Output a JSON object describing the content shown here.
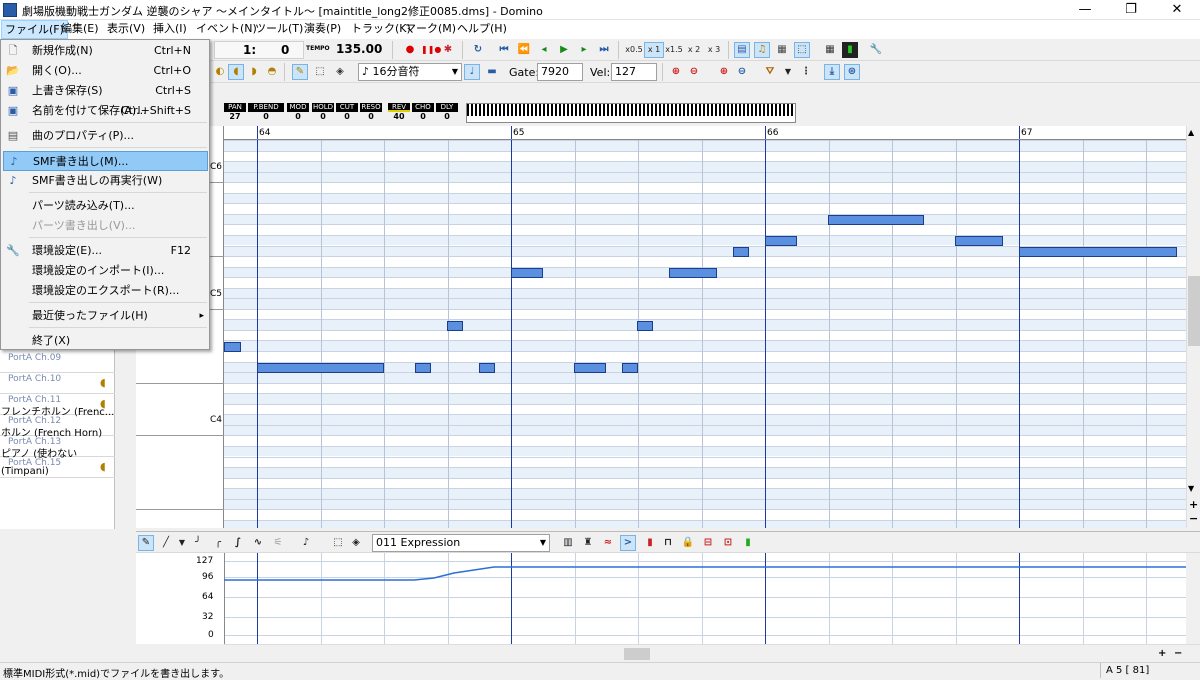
{
  "window": {
    "title": "劇場版機動戦士ガンダム 逆襲のシャア 〜メインタイトル〜 [maintitle_long2修正0085.dms] - Domino",
    "minimize": "—",
    "maximize": "❐",
    "close": "✕"
  },
  "menubar": [
    "ファイル(F)",
    "編集(E)",
    "表示(V)",
    "挿入(I)",
    "イベント(N)",
    "ツール(T)",
    "演奏(P)",
    "トラック(K)",
    "マーク(M)",
    "ヘルプ(H)"
  ],
  "file_menu": {
    "items": [
      {
        "label": "新規作成(N)",
        "shortcut": "Ctrl+N",
        "icon": "new-file-icon"
      },
      {
        "label": "開く(O)...",
        "shortcut": "Ctrl+O",
        "icon": "open-folder-icon"
      },
      {
        "label": "上書き保存(S)",
        "shortcut": "Ctrl+S",
        "icon": "save-icon"
      },
      {
        "label": "名前を付けて保存(A)...",
        "shortcut": "Ctrl+Shift+S",
        "icon": "save-as-icon"
      },
      {
        "label": "曲のプロパティ(P)...",
        "shortcut": "",
        "icon": "properties-icon"
      },
      {
        "label": "SMF書き出し(M)...",
        "shortcut": "",
        "icon": "export-smf-icon",
        "highlighted": true
      },
      {
        "label": "SMF書き出しの再実行(W)",
        "shortcut": "",
        "icon": "reexport-smf-icon"
      },
      {
        "label": "パーツ読み込み(T)...",
        "shortcut": "",
        "icon": ""
      },
      {
        "label": "パーツ書き出し(V)...",
        "shortcut": "",
        "icon": "",
        "disabled": true
      },
      {
        "label": "環境設定(E)...",
        "shortcut": "F12",
        "icon": "wrench-icon"
      },
      {
        "label": "環境設定のインポート(I)...",
        "shortcut": "",
        "icon": ""
      },
      {
        "label": "環境設定のエクスポート(R)...",
        "shortcut": "",
        "icon": ""
      },
      {
        "label": "最近使ったファイル(H)",
        "shortcut": "",
        "icon": "",
        "submenu": true
      },
      {
        "label": "終了(X)",
        "shortcut": "",
        "icon": ""
      }
    ],
    "submenu_arrow": "▸"
  },
  "transport": {
    "position_beat": "1:",
    "position_tick": "0",
    "tempo_label": "TEMPO",
    "tempo": "135.00",
    "speeds": [
      "x0.5",
      "x 1",
      "x1.5",
      "x 2",
      "x 3"
    ]
  },
  "edit_toolbar": {
    "note_length": "16分音符",
    "gate_label": "Gate:",
    "gate": "7920",
    "vel_label": "Vel:",
    "vel": "127"
  },
  "controllers": [
    {
      "name": "PAN",
      "value": "27"
    },
    {
      "name": "P.BEND",
      "value": "0"
    },
    {
      "name": "MOD",
      "value": "0"
    },
    {
      "name": "HOLD",
      "value": "0"
    },
    {
      "name": "CUT",
      "value": "0"
    },
    {
      "name": "RESO",
      "value": "0"
    },
    {
      "name": "REV",
      "value": "40"
    },
    {
      "name": "CHO",
      "value": "0"
    },
    {
      "name": "DLY",
      "value": "0"
    }
  ],
  "tracks": [
    {
      "port": "PortA  Ch.09",
      "name": ""
    },
    {
      "port": "PortA  Ch.10",
      "name": ""
    },
    {
      "port": "PortA  Ch.11",
      "name": "フレンチホルン (Frenc..."
    },
    {
      "port": "PortA  Ch.12",
      "name": "ホルン (French Horn)"
    },
    {
      "port": "PortA  Ch.13",
      "name": "ピアノ (使わない"
    },
    {
      "port": "PortA  Ch.15",
      "name": "(Timpani)"
    }
  ],
  "octave_labels": [
    "C6",
    "C5",
    "C4"
  ],
  "measures": [
    "64",
    "65",
    "66",
    "67"
  ],
  "graph": {
    "controller": "011 Expression",
    "y_labels": [
      "127",
      "96",
      "64",
      "32",
      "0"
    ],
    "values": [
      {
        "tick_start": 0,
        "value": 96
      },
      {
        "tick_ramp_end": 1.0,
        "value": 112
      }
    ]
  },
  "scroll_symbols": {
    "up": "▲",
    "down": "▼",
    "plus": "+",
    "minus": "−",
    "left": "◀",
    "right": "▶"
  },
  "status": {
    "message": "標準MIDI形式(*.mid)でファイルを書き出します。",
    "position": "A  5 [ 81]"
  }
}
